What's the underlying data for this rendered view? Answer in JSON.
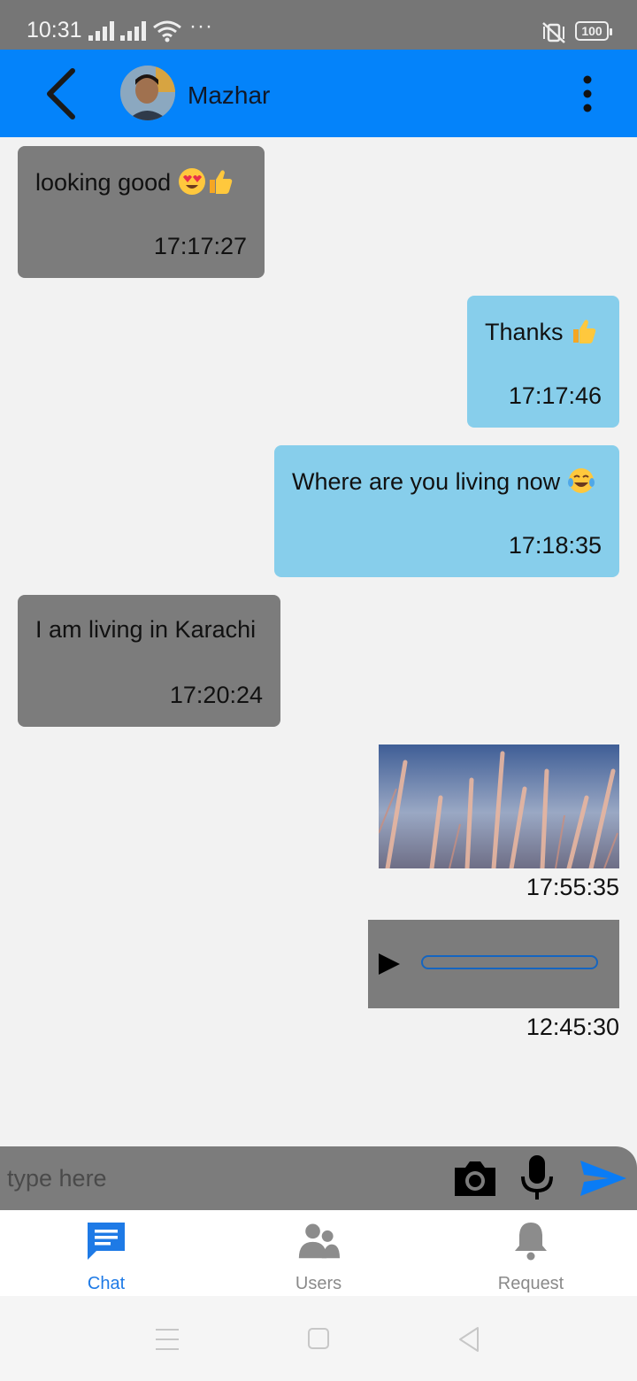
{
  "status_bar": {
    "time": "10:31",
    "dots": "···",
    "battery": "100"
  },
  "header": {
    "contact_name": "Mazhar"
  },
  "messages": [
    {
      "direction": "in",
      "text": "looking good",
      "emojis": [
        "heart-eyes",
        "thumbs-up"
      ],
      "time": "17:17:27"
    },
    {
      "direction": "out",
      "text": "Thanks",
      "emojis": [
        "thumbs-up"
      ],
      "time": "17:17:46"
    },
    {
      "direction": "out",
      "text": "Where are you living now",
      "emojis": [
        "tears-of-joy"
      ],
      "time": "17:18:35"
    },
    {
      "direction": "in",
      "text": "I am living in Karachi",
      "emojis": [],
      "time": "17:20:24"
    },
    {
      "direction": "out",
      "type": "image",
      "image_subject": "wheat-grass-photo",
      "time": "17:55:35"
    },
    {
      "direction": "out",
      "type": "audio",
      "time": "12:45:30"
    }
  ],
  "composer": {
    "placeholder": "type here"
  },
  "tabs": [
    {
      "label": "Chat",
      "icon": "chat-icon",
      "active": true
    },
    {
      "label": "Users",
      "icon": "users-icon",
      "active": false
    },
    {
      "label": "Request",
      "icon": "bell-icon",
      "active": false
    }
  ],
  "colors": {
    "header": "#0483fa",
    "incoming_bubble": "#7c7c7c",
    "outgoing_bubble": "#87ceeb",
    "composer": "#7c7c7c",
    "active_tab": "#1e7ae6",
    "status_bar": "#767676"
  }
}
